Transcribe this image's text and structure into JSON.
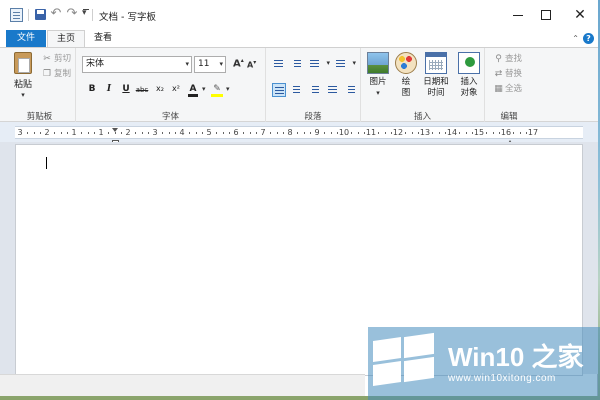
{
  "window": {
    "title": "文档 - 写字板"
  },
  "quick_access": {
    "icons": [
      "wordpad-app-icon",
      "save-icon",
      "undo-icon",
      "redo-icon",
      "customize-qat-icon"
    ]
  },
  "tabs": [
    {
      "label": "文件",
      "active": false,
      "style": "file"
    },
    {
      "label": "主页",
      "active": true
    },
    {
      "label": "查看",
      "active": false
    }
  ],
  "ribbon": {
    "clipboard": {
      "label": "剪贴板",
      "paste": "粘贴",
      "cut": "剪切",
      "copy": "复制"
    },
    "font": {
      "label": "字体",
      "font_name": "宋体",
      "font_size": "11"
    },
    "paragraph": {
      "label": "段落"
    },
    "insert": {
      "label": "插入",
      "picture": "图片",
      "paint_line1": "绘",
      "paint_line2": "图",
      "date_line1": "日期和",
      "date_line2": "时间",
      "object_line1": "插入",
      "object_line2": "对象"
    },
    "edit": {
      "label": "编辑",
      "find": "查找",
      "replace": "替换",
      "select_all": "全选"
    }
  },
  "ruler": {
    "numbers": [
      "3",
      "2",
      "1",
      "1",
      "2",
      "3",
      "4",
      "5",
      "6",
      "7",
      "8",
      "9",
      "10",
      "11",
      "12",
      "13",
      "14",
      "15",
      "16",
      "17"
    ]
  },
  "watermark": {
    "title": "Win10 之家",
    "url": "www.win10xitong.com"
  },
  "colors": {
    "accent": "#1979ca",
    "ribbon_bg": "#f5f6f7",
    "ruler_bg": "#e6edf6"
  }
}
